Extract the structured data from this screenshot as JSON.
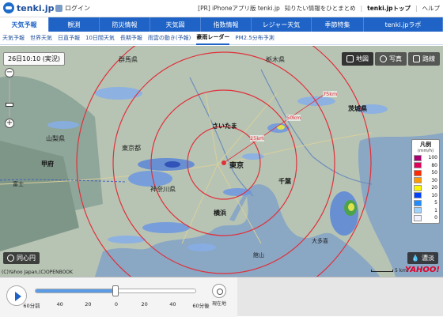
{
  "header": {
    "logo_text": "tenki.jp",
    "login_label": "ログイン",
    "links": [
      "[PR] iPhoneアプリ版 tenki.jp",
      "知りたい情報をひとまとめ",
      "tenki.jpトップ",
      "ヘルプ"
    ]
  },
  "main_nav": {
    "items": [
      {
        "label": "天気予報",
        "active": true
      },
      {
        "label": "観測",
        "active": false
      },
      {
        "label": "防災情報",
        "active": false
      },
      {
        "label": "天気図",
        "active": false
      },
      {
        "label": "指数情報",
        "active": false
      },
      {
        "label": "レジャー天気",
        "active": false
      },
      {
        "label": "季節特集",
        "active": false
      },
      {
        "label": "tenki.jpラボ",
        "active": false
      }
    ]
  },
  "sub_nav": {
    "items": [
      {
        "label": "天気予報",
        "active": false
      },
      {
        "label": "世界天気",
        "active": false
      },
      {
        "label": "日直予報",
        "active": false
      },
      {
        "label": "10日間天気",
        "active": false
      },
      {
        "label": "長期予報",
        "active": false
      },
      {
        "label": "雨雲の動き(予報)",
        "active": false
      },
      {
        "label": "豪雨レーダー",
        "active": true
      },
      {
        "label": "PM2.5分布予測",
        "active": false
      }
    ]
  },
  "map": {
    "timestamp": "26日10:10 (実況)",
    "map_type_buttons": [
      "地図",
      "写真",
      "路線"
    ],
    "concentric_label": "同心円",
    "opacity_label": "濃淡",
    "copyright": "(C)Yahoo Japan,(C)OPENBOOK",
    "provider": "YAHOO!",
    "scale_label": "5 km",
    "ring_labels": [
      "25km",
      "50km",
      "75km"
    ],
    "place_labels": [
      "東京",
      "さいたま",
      "千葉",
      "横浜",
      "甲府",
      "茨城県",
      "山梨県",
      "東京都",
      "神奈川県",
      "群馬県",
      "栃木県",
      "館山",
      "大多喜",
      "富士"
    ]
  },
  "legend": {
    "title": "凡例",
    "unit": "(mm/h)",
    "levels": [
      {
        "value": "100",
        "color": "#a8006e"
      },
      {
        "value": "80",
        "color": "#e0005a"
      },
      {
        "value": "50",
        "color": "#ff2800"
      },
      {
        "value": "30",
        "color": "#ff9900"
      },
      {
        "value": "20",
        "color": "#faf500"
      },
      {
        "value": "10",
        "color": "#0041ff"
      },
      {
        "value": "5",
        "color": "#218cff"
      },
      {
        "value": "1",
        "color": "#a0d2ff"
      },
      {
        "value": "0",
        "color": "#f2f2ff"
      }
    ]
  },
  "timeline": {
    "play_label": "再生",
    "tick_labels": [
      "60分前",
      "40",
      "20",
      "0",
      "20",
      "40",
      "60分後"
    ],
    "current_position_fraction": 0.5,
    "location_label": "現在地"
  },
  "colors": {
    "brand_blue": "#1f63c6",
    "ring_red": "#e0303a"
  }
}
